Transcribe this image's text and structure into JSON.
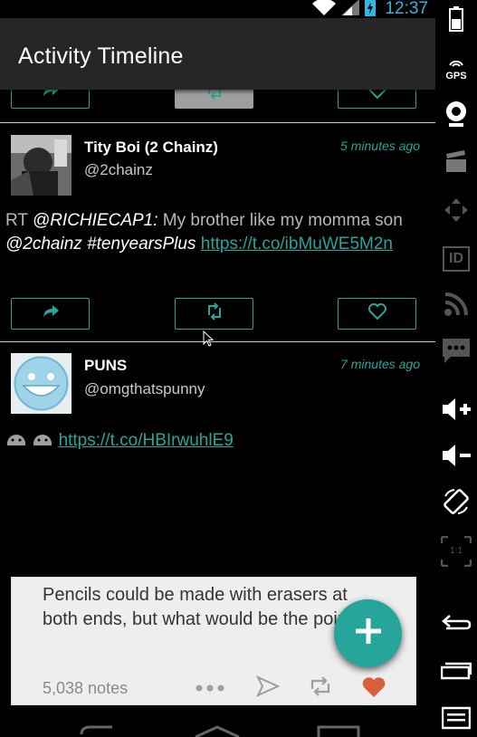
{
  "status_bar": {
    "time": "12:37",
    "icons": [
      "wifi-icon",
      "signal-icon",
      "battery-charging-icon"
    ]
  },
  "app_bar": {
    "title": "Activity Timeline"
  },
  "tweets": [
    {
      "name": "Tity Boi (2 Chainz)",
      "handle": "@2chainz",
      "time": "5 minutes ago",
      "body": {
        "prefix": "RT ",
        "mention1": "@RICHIECAP1:",
        "text1": " My brother like my momma son ",
        "mention2": "@2chainz",
        "space": " ",
        "hashtag": "#tenyearsPlus",
        "space2": " ",
        "link": "https://t.co/ibMuWE5M2n"
      }
    },
    {
      "name": "PUNS",
      "handle": "@omgthatspunny",
      "time": "7 minutes ago",
      "body": {
        "link": "https://t.co/HBIrwuhlE9"
      },
      "media": {
        "text": "Pencils could be made with erasers at both ends, but what would be the point?",
        "notes": "5,038 notes"
      }
    }
  ],
  "actions": {
    "reply_icon": "reply-icon",
    "retweet_icon": "retweet-icon",
    "favorite_icon": "heart-icon"
  },
  "fab": {
    "icon": "plus-icon"
  },
  "emulator_toolbar": {
    "gps_label": "GPS",
    "id_label": "ID",
    "scale_label": "1:1"
  },
  "colors": {
    "accent": "#26a69a",
    "app_bar": "#262626",
    "clock": "#33b5e5"
  }
}
